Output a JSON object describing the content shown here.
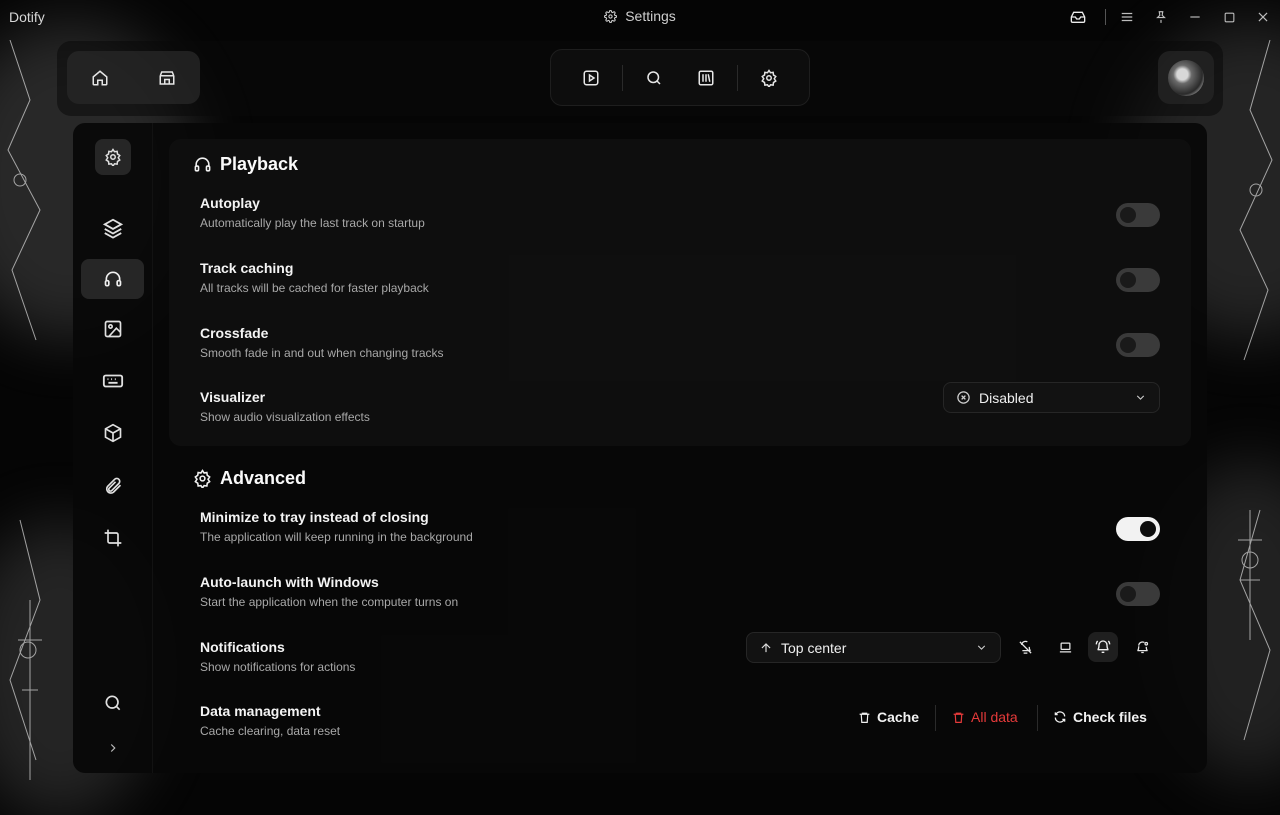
{
  "titlebar": {
    "app_name": "Dotify",
    "title": "Settings"
  },
  "icons": {
    "home": "home-icon",
    "store": "store-icon",
    "player": "play-square-icon",
    "search": "search-icon",
    "library": "library-icon",
    "settings": "gear-icon"
  },
  "sections": {
    "playback": {
      "title": "Playback",
      "rows": [
        {
          "title": "Autoplay",
          "desc": "Automatically play the last track on startup",
          "toggle": false
        },
        {
          "title": "Track caching",
          "desc": "All tracks will be cached for faster playback",
          "toggle": false
        },
        {
          "title": "Crossfade",
          "desc": "Smooth fade in and out when changing tracks",
          "toggle": false
        },
        {
          "title": "Visualizer",
          "desc": "Show audio visualization effects",
          "select": "Disabled"
        }
      ]
    },
    "advanced": {
      "title": "Advanced",
      "rows": [
        {
          "title": "Minimize to tray instead of closing",
          "desc": "The application will keep running in the background",
          "toggle": true
        },
        {
          "title": "Auto-launch with Windows",
          "desc": "Start the application when the computer turns on",
          "toggle": false
        },
        {
          "title": "Notifications",
          "desc": "Show notifications for actions",
          "select": "Top center"
        },
        {
          "title": "Data management",
          "desc": "Cache clearing, data reset"
        }
      ],
      "data_actions": {
        "cache": "Cache",
        "all_data": "All data",
        "check_files": "Check files"
      }
    }
  },
  "colors": {
    "accent_danger": "#e53a3a",
    "toggle_on": "#f2f2f2",
    "toggle_off": "#3a3a3a"
  }
}
